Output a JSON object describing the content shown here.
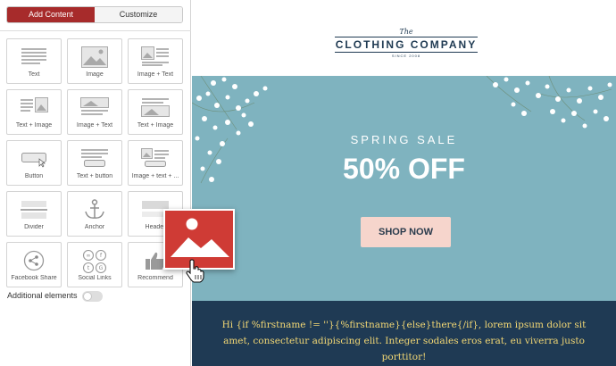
{
  "sidebar": {
    "tabs": [
      {
        "label": "Add Content",
        "active": true
      },
      {
        "label": "Customize",
        "active": false
      }
    ],
    "tiles": [
      {
        "label": "Text",
        "icon": "text-icon"
      },
      {
        "label": "Image",
        "icon": "image-icon"
      },
      {
        "label": "Image + Text",
        "icon": "image-text-icon"
      },
      {
        "label": "Text + Image",
        "icon": "text-image-icon"
      },
      {
        "label": "Image + Text",
        "icon": "image-over-text-icon"
      },
      {
        "label": "Text + Image",
        "icon": "text-over-image-icon"
      },
      {
        "label": "Button",
        "icon": "button-icon"
      },
      {
        "label": "Text + button",
        "icon": "text-button-icon"
      },
      {
        "label": "Image + text + ...",
        "icon": "image-text-button-icon"
      },
      {
        "label": "Divider",
        "icon": "divider-icon"
      },
      {
        "label": "Anchor",
        "icon": "anchor-icon"
      },
      {
        "label": "Header",
        "icon": "header-icon"
      },
      {
        "label": "Facebook Share",
        "icon": "share-icon"
      },
      {
        "label": "Social Links",
        "icon": "social-links-icon"
      },
      {
        "label": "Recommend",
        "icon": "thumbs-up-icon"
      }
    ],
    "additional_elements_label": "Additional elements",
    "additional_elements_enabled": false
  },
  "email": {
    "logo": {
      "the": "The",
      "name": "CLOTHING COMPANY",
      "since": "SINCE 2008"
    },
    "hero": {
      "tagline": "SPRING SALE",
      "headline": "50% OFF",
      "cta": "SHOP NOW"
    },
    "footer_text": "Hi {if %firstname != ''}{%firstname}{else}there{/if}, lorem ipsum dolor sit amet, consectetur adipiscing elit. Integer sodales eros erat, eu viverra justo porttitor!"
  },
  "drag_ghost": {
    "icon": "image-icon"
  },
  "cursor": {
    "icon": "hand-pointer-icon"
  },
  "colors": {
    "accent": "#a72b2b",
    "hero_bg": "#7fb3bf",
    "footer_bg": "#1f3a54",
    "footer_text": "#f2d774",
    "cta_bg": "#f6d5cc",
    "ghost_bg": "#cf3b35"
  }
}
